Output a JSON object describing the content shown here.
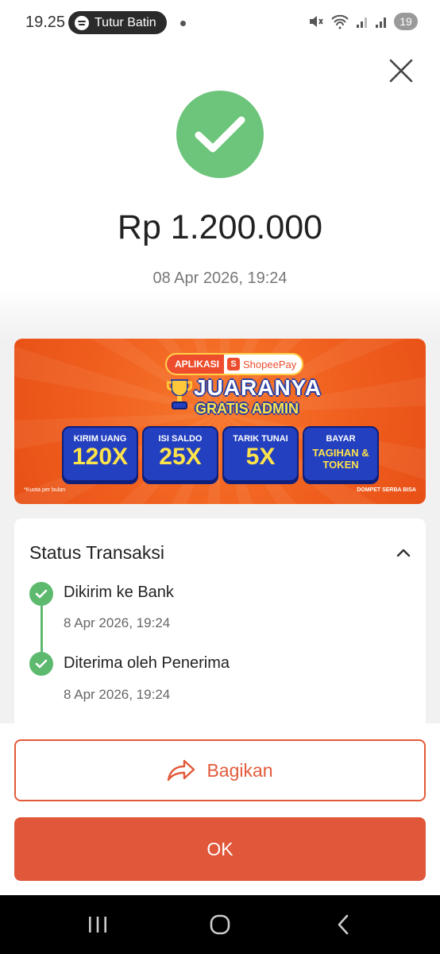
{
  "status_bar": {
    "time": "19.25",
    "media_title": "Tutur Batin",
    "battery": "19"
  },
  "transaction": {
    "amount": "Rp 1.200.000",
    "datetime": "08 Apr 2026, 19:24",
    "success_color": "#6cc57b"
  },
  "banner": {
    "app_label": "APLIKASI",
    "brand": "ShopeePay",
    "headline": "JUARANYA",
    "subheadline": "GRATIS ADMIN",
    "cards": [
      {
        "label": "KIRIM UANG",
        "value": "120X"
      },
      {
        "label": "ISI SALDO",
        "value": "25X"
      },
      {
        "label": "TARIK TUNAI",
        "value": "5X"
      },
      {
        "label": "BAYAR",
        "value": "TAGIHAN & TOKEN"
      }
    ],
    "note": "*Kuota per bulan",
    "tagline": "DOMPET SERBA BISA"
  },
  "status": {
    "title": "Status Transaksi",
    "steps": [
      {
        "title": "Dikirim ke Bank",
        "time": "8 Apr 2026, 19:24"
      },
      {
        "title": "Diterima oleh Penerima",
        "time": "8 Apr 2026, 19:24"
      }
    ]
  },
  "actions": {
    "share_label": "Bagikan",
    "ok_label": "OK",
    "accent_color": "#e0573a"
  }
}
